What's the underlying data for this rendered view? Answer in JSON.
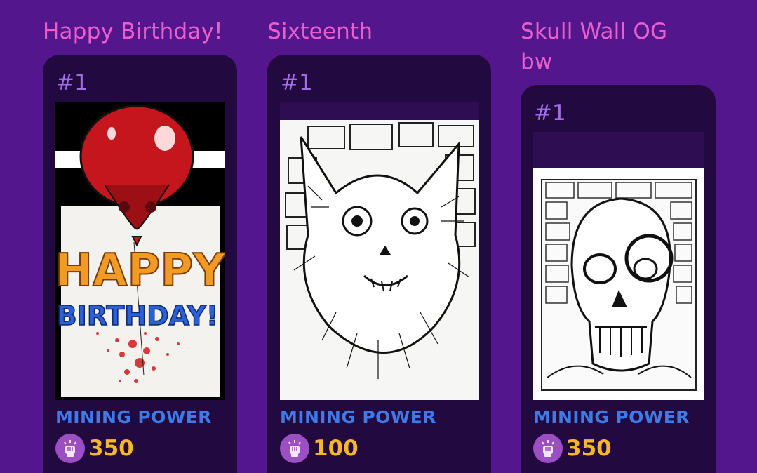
{
  "colors": {
    "background": "#54168c",
    "card": "#22093f",
    "title": "#ea5fcd",
    "card_number": "#a06ce8",
    "mining_label": "#3f7ae6",
    "mining_value": "#f5b728",
    "mining_icon_bg": "#9b4fc2"
  },
  "cards": [
    {
      "title": "Happy Birthday!",
      "number": "#1",
      "artwork_text": {
        "line1": "HAPPY",
        "line2": "BIRTHDAY!"
      },
      "mining_label": "MINING POWER",
      "mining_value": "350",
      "icon": "mining-power-icon"
    },
    {
      "title": "Sixteenth",
      "number": "#1",
      "mining_label": "MINING POWER",
      "mining_value": "100",
      "icon": "mining-power-icon"
    },
    {
      "title_line1": "Skull Wall OG",
      "title_line2": "bw",
      "number": "#1",
      "mining_label": "MINING POWER",
      "mining_value": "350",
      "icon": "mining-power-icon"
    }
  ]
}
